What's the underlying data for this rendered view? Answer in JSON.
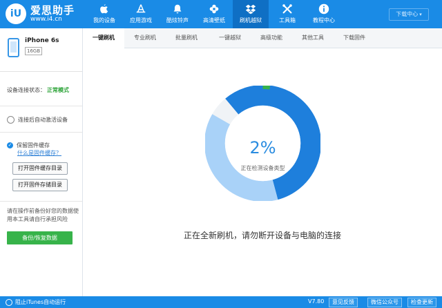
{
  "header": {
    "brand": "爱思助手",
    "url": "www.i4.cn",
    "logo_text": "iU",
    "download_center": "下载中心",
    "nav": [
      {
        "label": "我的设备",
        "icon": "apple-icon"
      },
      {
        "label": "应用游戏",
        "icon": "app-store-icon"
      },
      {
        "label": "酷炫铃声",
        "icon": "bell-icon"
      },
      {
        "label": "高清壁纸",
        "icon": "flower-icon"
      },
      {
        "label": "刷机越狱",
        "icon": "dropbox-icon"
      },
      {
        "label": "工具箱",
        "icon": "tools-icon"
      },
      {
        "label": "教程中心",
        "icon": "info-icon"
      }
    ],
    "active_nav": "刷机越狱"
  },
  "sidebar": {
    "device_name": "iPhone 6s",
    "storage": "16GB",
    "status_label": "设备连接状态：",
    "status_value": "正常模式",
    "auto_activate": "连接后自动激活设备",
    "keep_firmware": "保留固件缓存",
    "what_is_cache": "什么是固件缓存？",
    "open_cache_dir": "打开固件缓存目录",
    "open_storage_dir": "打开固件存储目录",
    "tip": "请在操作前备份好您的数据使用本工具请自行承担风险",
    "backup_button": "备份/恢复数据"
  },
  "tabs": [
    "一键刷机",
    "专业刷机",
    "批量刷机",
    "一键越狱",
    "高级功能",
    "其他工具",
    "下载固件"
  ],
  "active_tab": "一键刷机",
  "main": {
    "progress_text": "2%",
    "progress_fraction": 0.02,
    "progress_subtext": "正在检测设备类型",
    "message": "正在全新刷机，请勿断开设备与电脑的连接"
  },
  "footer": {
    "itunes_toggle": "阻止iTunes自动运行",
    "version": "V7.80",
    "feedback": "意见反馈",
    "wechat": "微信公众号",
    "check_update": "检查更新"
  },
  "colors": {
    "primary": "#1a8be6",
    "active_nav": "#0f6fc4",
    "success": "#37b34a",
    "ring_dark": "#1e7fdc",
    "ring_light": "#a9d2f8"
  }
}
